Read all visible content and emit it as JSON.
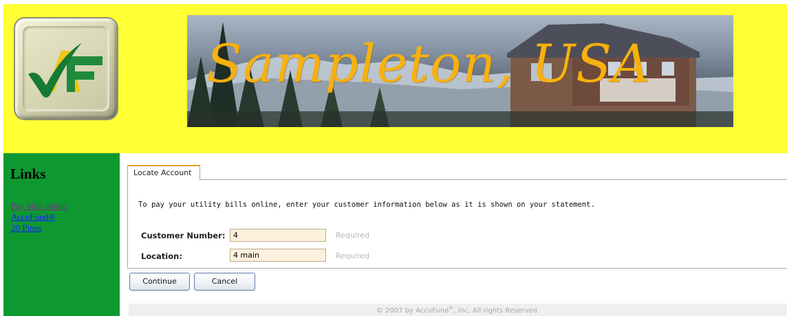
{
  "header": {
    "logo_icon": "accufund-checkmark-logo",
    "banner_title": "Sampleton, USA",
    "background_color": "#ffff33"
  },
  "sidebar": {
    "title": "Links",
    "links": [
      {
        "label": "Pay bills online"
      },
      {
        "label": "AccuFund®"
      },
      {
        "label": "20 Pines"
      }
    ],
    "background_color": "#0d9930"
  },
  "main": {
    "tab_label": "Locate Account",
    "instructions": "To pay your utility bills online, enter your customer information below as it is shown on your statement.",
    "fields": [
      {
        "label": "Customer Number:",
        "value": "4",
        "hint": "Required"
      },
      {
        "label": "Location:",
        "value": "4 main",
        "hint": "Required"
      }
    ],
    "buttons": {
      "continue_label": "Continue",
      "cancel_label": "Cancel"
    }
  },
  "footer": {
    "prefix": "© 2007 by AccuFund",
    "registered_mark": "®",
    "suffix": ", Inc. All rights Reserved."
  }
}
